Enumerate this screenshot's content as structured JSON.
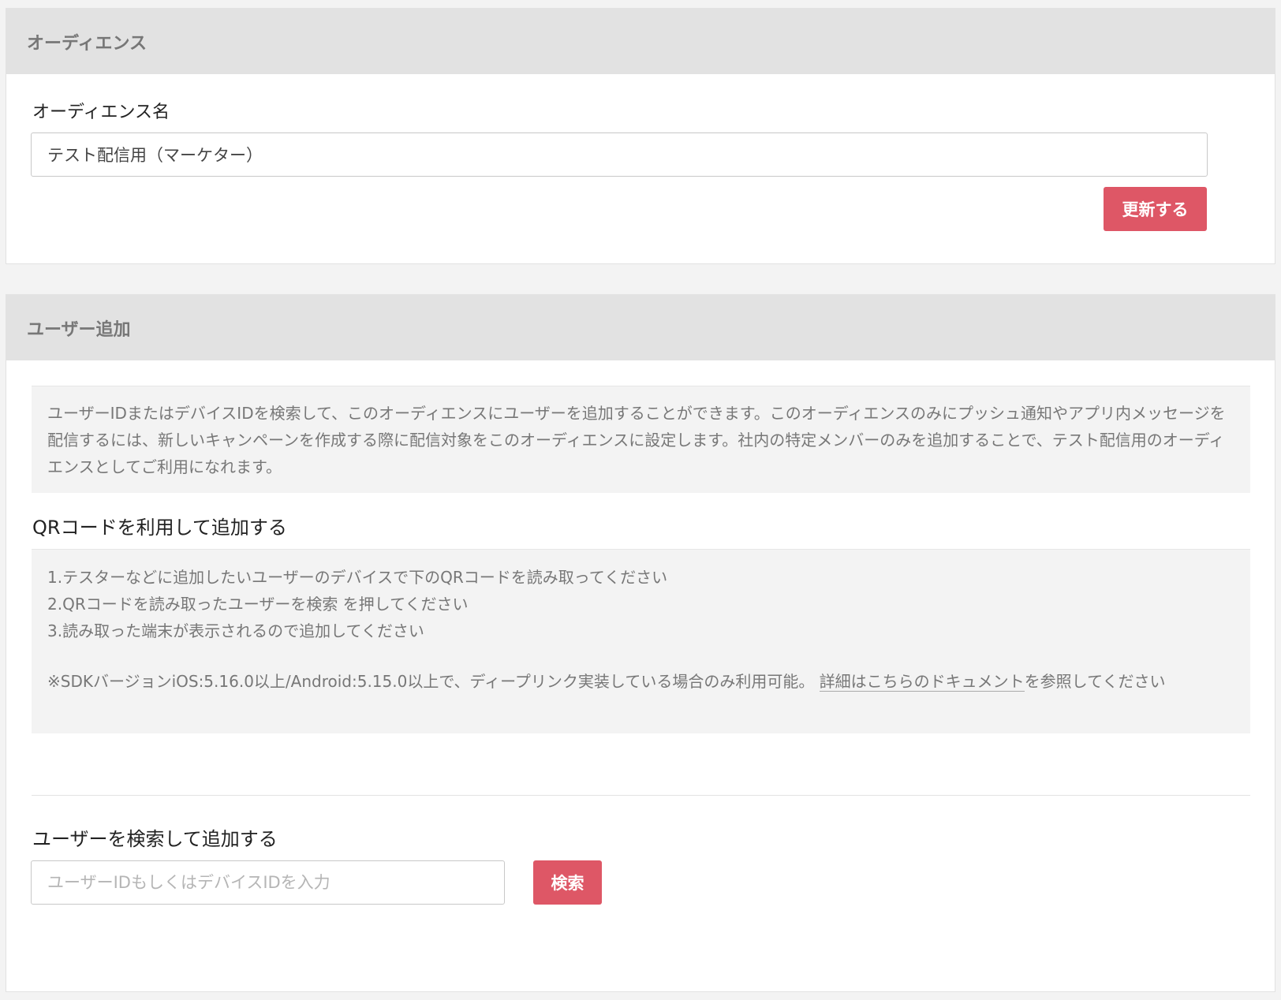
{
  "audience_panel": {
    "header": "オーディエンス",
    "name_label": "オーディエンス名",
    "name_value": "テスト配信用（マーケター）",
    "update_button": "更新する"
  },
  "add_user_panel": {
    "header": "ユーザー追加",
    "description": "ユーザーIDまたはデバイスIDを検索して、このオーディエンスにユーザーを追加することができます。このオーディエンスのみにプッシュ通知やアプリ内メッセージを配信するには、新しいキャンペーンを作成する際に配信対象をこのオーディエンスに設定します。社内の特定メンバーのみを追加することで、テスト配信用のオーディエンスとしてご利用になれます。",
    "qr_section": {
      "title": "QRコードを利用して追加する",
      "steps": [
        "1.テスターなどに追加したいユーザーのデバイスで下のQRコードを読み取ってください",
        "2.QRコードを読み取ったユーザーを検索 を押してください",
        "3.読み取った端末が表示されるので追加してください"
      ],
      "note_prefix": "※SDKバージョンiOS:5.16.0以上/Android:5.15.0以上で、ディープリンク実装している場合のみ利用可能。",
      "note_link": "詳細はこちらのドキュメント",
      "note_suffix": "を参照してください"
    },
    "search_section": {
      "title": "ユーザーを検索して追加する",
      "placeholder": "ユーザーIDもしくはデバイスIDを入力",
      "search_button": "検索"
    }
  },
  "colors": {
    "accent": "#de5766",
    "header_bg": "#e2e2e2",
    "info_bg": "#f3f3f3"
  }
}
